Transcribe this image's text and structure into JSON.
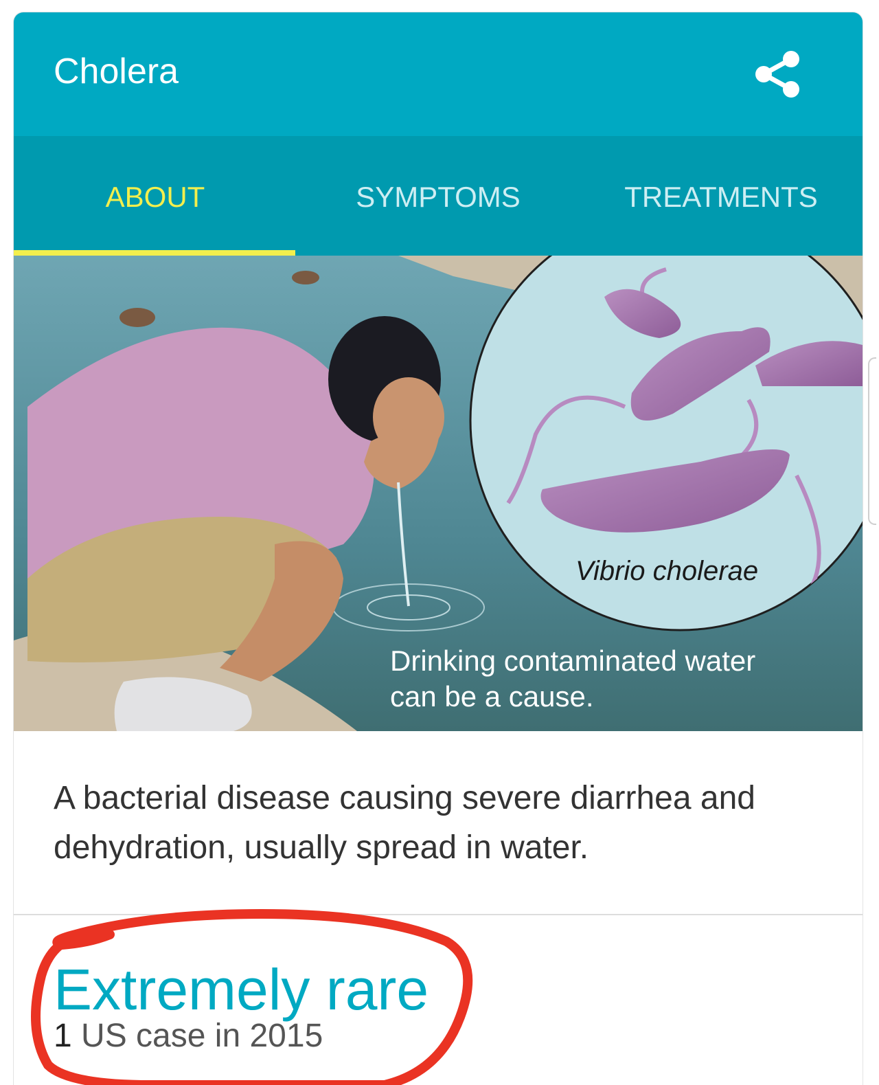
{
  "header": {
    "title": "Cholera",
    "share_icon": "share-icon"
  },
  "tabs": [
    {
      "label": "ABOUT",
      "active": true
    },
    {
      "label": "SYMPTOMS",
      "active": false
    },
    {
      "label": "TREATMENTS",
      "active": false
    }
  ],
  "hero": {
    "inset_label": "Vibrio cholerae",
    "caption_line1": "Drinking contaminated water",
    "caption_line2": "can be a cause."
  },
  "description": "A bacterial disease causing severe diarrhea and dehydration, usually spread in water.",
  "stat": {
    "headline": "Extremely rare",
    "count": "1",
    "detail": " US case in 2015"
  },
  "colors": {
    "header": "#00a9c2",
    "tab_bar": "#009aaf",
    "active_tab": "#f3ef4d",
    "annotation": "#ea3323"
  }
}
